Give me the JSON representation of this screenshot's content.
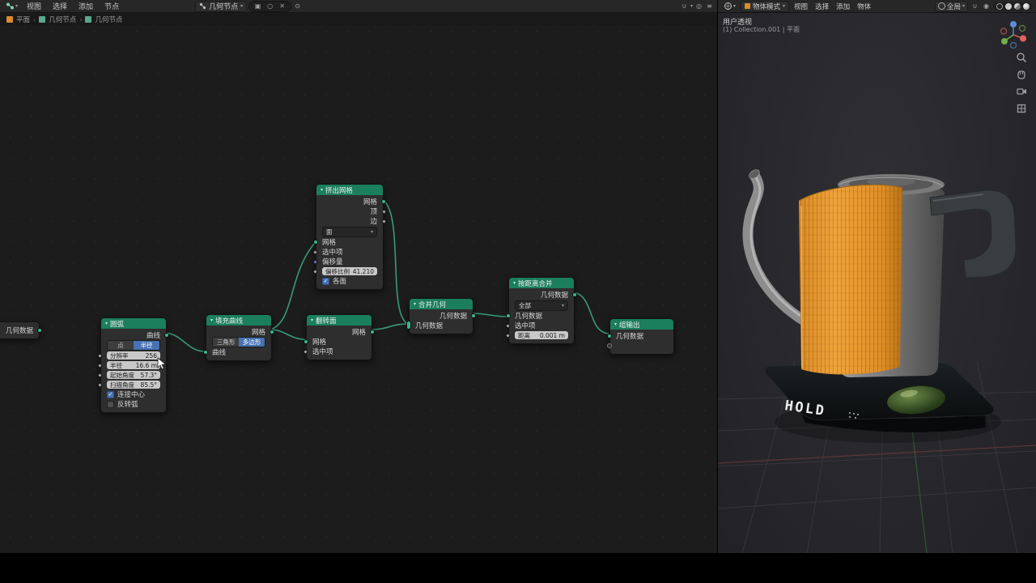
{
  "node_editor": {
    "header": {
      "menus": [
        "视图",
        "选择",
        "添加",
        "节点"
      ],
      "tree_name": "几何节点"
    },
    "breadcrumb": [
      "平面",
      "几何节点",
      "几何节点"
    ],
    "nodes": {
      "group_input": {
        "title": "几何数据"
      },
      "arc": {
        "title": "圆弧",
        "output": "曲线",
        "mode_point": "点",
        "mode_radius": "半径",
        "fields": [
          {
            "label": "分辨率",
            "value": "256"
          },
          {
            "label": "半径",
            "value": "16.6 m"
          },
          {
            "label": "起始角度",
            "value": "57.3°"
          },
          {
            "label": "扫描角度",
            "value": "85.5°"
          }
        ],
        "connect_center": "连接中心",
        "invert_arc": "反转弧"
      },
      "fill_curve": {
        "title": "填充曲线",
        "output": "网格",
        "mode_triangles": "三角形",
        "mode_ngons": "多边形",
        "input": "曲线"
      },
      "extrude_mesh": {
        "title": "挤出网格",
        "outputs": [
          "网格",
          "顶",
          "边"
        ],
        "mode": "面",
        "inputs": [
          "网格",
          "选中项",
          "偏移量"
        ],
        "offset_scale_label": "偏移比例",
        "offset_scale_value": "41.210",
        "individual": "各面"
      },
      "flip_faces": {
        "title": "翻转面",
        "output": "网格",
        "inputs": [
          "网格",
          "选中项"
        ]
      },
      "join_geometry": {
        "title": "合并几何",
        "output": "几何数据",
        "input": "几何数据"
      },
      "merge_by_distance": {
        "title": "按距离合并",
        "output": "几何数据",
        "mode": "全部",
        "inputs": [
          "几何数据",
          "选中项"
        ],
        "distance_label": "距离",
        "distance_value": "0.001 m"
      },
      "group_output": {
        "title": "组输出",
        "input": "几何数据"
      }
    }
  },
  "viewport": {
    "header": {
      "mode": "物体模式",
      "menus": [
        "视图",
        "选择",
        "添加",
        "物体"
      ],
      "orientation": "全局"
    },
    "overlay": {
      "view_label": "用户透视",
      "collection_label": "(1) Collection.001 | 平面"
    },
    "kettle": {
      "base_text": "HOLD"
    }
  },
  "colors": {
    "accent_blue": "#4772b3",
    "node_header_green": "#1b7e5c",
    "socket_teal": "#35b88c",
    "selection_orange": "#e8952f"
  }
}
